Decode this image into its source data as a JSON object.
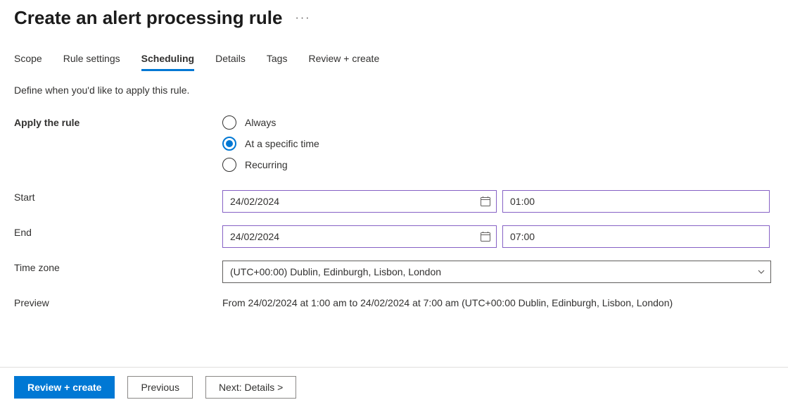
{
  "page_title": "Create an alert processing rule",
  "tabs": [
    {
      "label": "Scope"
    },
    {
      "label": "Rule settings"
    },
    {
      "label": "Scheduling",
      "active": true
    },
    {
      "label": "Details"
    },
    {
      "label": "Tags"
    },
    {
      "label": "Review + create"
    }
  ],
  "description": "Define when you'd like to apply this rule.",
  "apply_label": "Apply the rule",
  "radio": {
    "always": "Always",
    "specific": "At a specific time",
    "recurring": "Recurring"
  },
  "start_label": "Start",
  "end_label": "End",
  "tz_label": "Time zone",
  "preview_label": "Preview",
  "start_date": "24/02/2024",
  "start_time": "01:00",
  "end_date": "24/02/2024",
  "end_time": "07:00",
  "timezone": "(UTC+00:00) Dublin, Edinburgh, Lisbon, London",
  "preview_text": "From 24/02/2024 at 1:00 am to 24/02/2024 at 7:00 am (UTC+00:00 Dublin, Edinburgh, Lisbon, London)",
  "footer": {
    "review": "Review + create",
    "previous": "Previous",
    "next": "Next: Details >"
  }
}
